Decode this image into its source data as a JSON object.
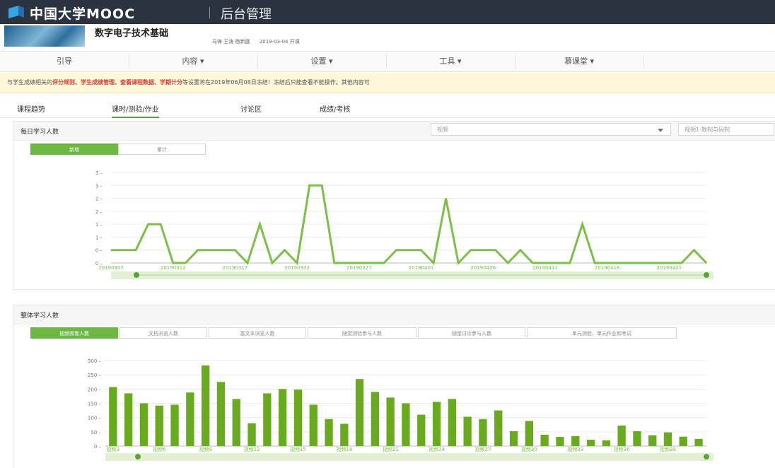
{
  "header": {
    "brand": "中国大学MOOC",
    "section": "后台管理"
  },
  "course": {
    "title": "数字电子技术基础",
    "meta": "马锋 王涛 杨新庭      2019-03-04 开课"
  },
  "menu": [
    "引导",
    "内容 ▾",
    "设置 ▾",
    "工具 ▾",
    "慕课堂 ▾"
  ],
  "notice": {
    "prefix": "与学生成绩相关的",
    "links": [
      "评分规则、",
      "学生成绩管理、",
      "查看课程数据、",
      "学期计分"
    ],
    "suffix": "等设置将在2019年06月08日冻结！冻结后只能查看不能操作。其他内容可"
  },
  "tabs": [
    "课程趋势",
    "课时/测验/作业",
    "讨论区",
    "成绩/考核"
  ],
  "active_tab": 1,
  "daily_panel": {
    "title": "每日学习人数",
    "select1": "视频",
    "select2": "视频1-数制与码制",
    "toggles": [
      "新增",
      "累计"
    ],
    "active_toggle": 0
  },
  "overall_panel": {
    "title": "整体学习人数",
    "toggles": [
      "视频观看人数",
      "文档浏览人数",
      "富文本浏览人数",
      "随堂测验参与人数",
      "随堂讨论参与人数",
      "单元测验、单元作业和考试"
    ],
    "active_toggle": 0
  },
  "colors": {
    "accent": "#6db842",
    "line": "#7cc04a",
    "bar": "#6aaa1e",
    "topbar": "#2b3340"
  },
  "chart_data": [
    {
      "type": "line",
      "title": "",
      "x_tick_labels": [
        "20190307",
        "20190312",
        "20190317",
        "20190322",
        "20190327",
        "20190401",
        "20190406",
        "20190411",
        "20190416",
        "20190421"
      ],
      "y_tick_labels": [
        "0",
        "0",
        "1",
        "1",
        "2",
        "2",
        "3",
        "3"
      ],
      "ylim": [
        0,
        3.5
      ],
      "grid": true,
      "values": [
        0.5,
        0.5,
        0.5,
        1.5,
        1.5,
        0,
        0,
        0.5,
        0.5,
        0.5,
        0.5,
        0,
        1.5,
        0,
        0.5,
        0,
        3,
        3,
        0,
        0,
        0,
        0,
        0,
        0.5,
        0.5,
        0.5,
        0,
        2.5,
        0,
        0.5,
        0.5,
        0.5,
        0,
        0.5,
        0,
        0,
        0,
        0,
        1.5,
        0,
        0,
        0,
        0,
        0,
        0,
        0,
        0,
        0.5,
        0
      ]
    },
    {
      "type": "bar",
      "title": "",
      "categories": [
        "视频3",
        "视频6",
        "视频9",
        "视频12",
        "视频15",
        "视频18",
        "视频21",
        "视频24",
        "视频27",
        "视频30",
        "视频33",
        "视频36",
        "视频39"
      ],
      "y_tick_labels": [
        "0",
        "50",
        "100",
        "150",
        "200",
        "250",
        "300"
      ],
      "ylim": [
        0,
        300
      ],
      "grid": true,
      "values": [
        207,
        185,
        150,
        142,
        145,
        188,
        283,
        225,
        165,
        80,
        185,
        200,
        198,
        145,
        95,
        78,
        235,
        190,
        170,
        150,
        110,
        155,
        165,
        103,
        95,
        125,
        52,
        88,
        40,
        32,
        35,
        22,
        20,
        72,
        52,
        38,
        48,
        33,
        25
      ]
    }
  ]
}
